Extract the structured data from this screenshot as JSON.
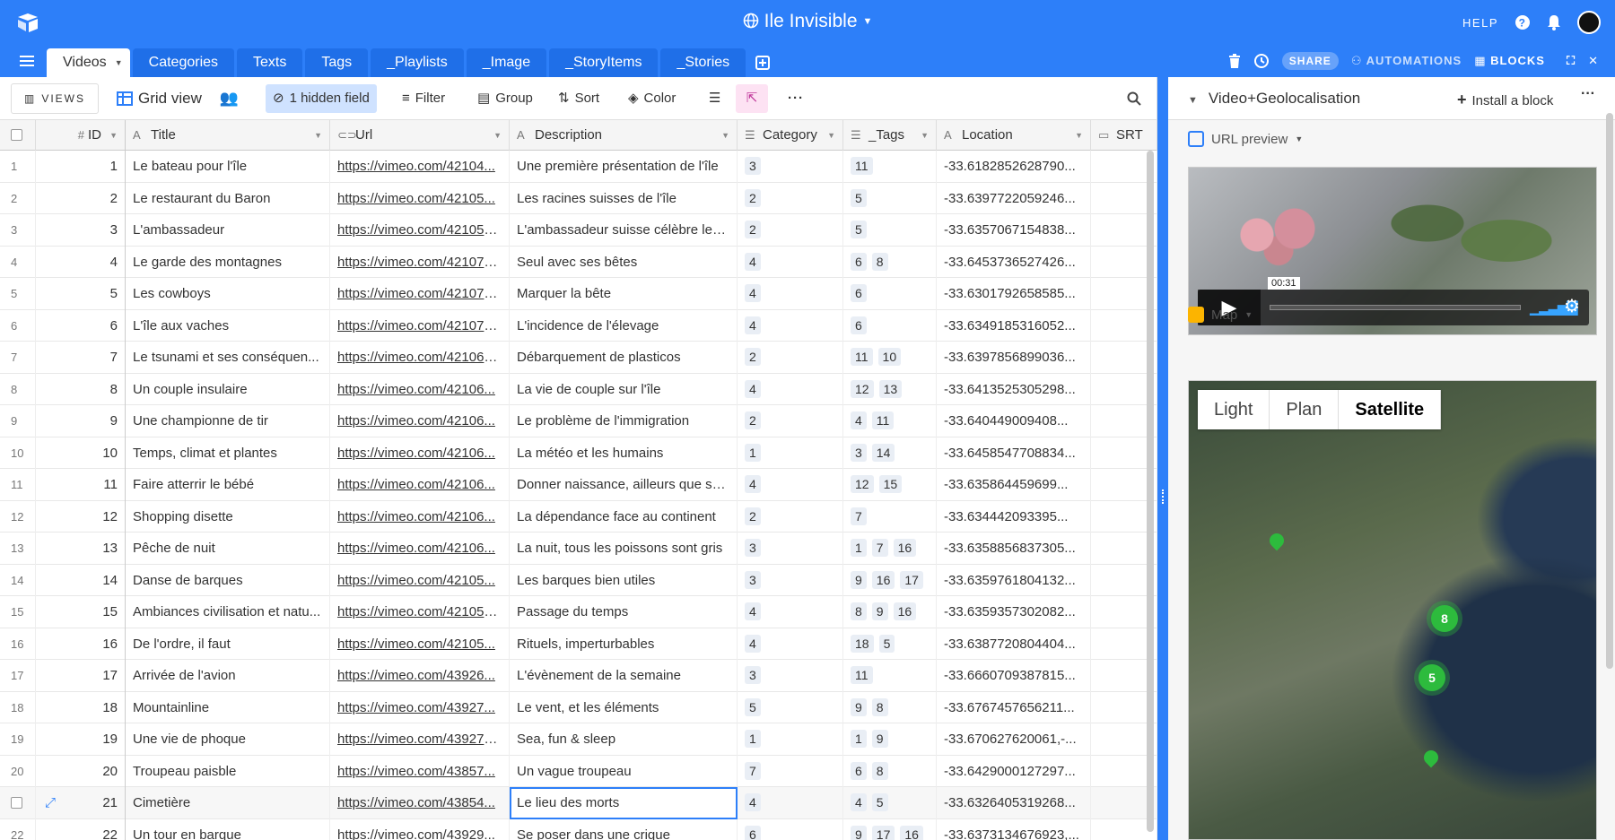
{
  "topbar": {
    "base_title": "Ile Invisible",
    "help_label": "HELP"
  },
  "tabs": [
    {
      "label": "Videos",
      "active": true
    },
    {
      "label": "Categories"
    },
    {
      "label": "Texts"
    },
    {
      "label": "Tags"
    },
    {
      "label": "_Playlists"
    },
    {
      "label": "_Image"
    },
    {
      "label": "_StoryItems"
    },
    {
      "label": "_Stories"
    }
  ],
  "tabs_right": {
    "share_label": "SHARE",
    "automations_label": "AUTOMATIONS",
    "blocks_label": "BLOCKS"
  },
  "toolbar": {
    "views_label": "VIEWS",
    "view_name": "Grid view",
    "hidden_field_label": "1 hidden field",
    "filter_label": "Filter",
    "group_label": "Group",
    "sort_label": "Sort",
    "color_label": "Color"
  },
  "columns": {
    "id": "ID",
    "title": "Title",
    "url": "Url",
    "description": "Description",
    "category": "Category",
    "tags": "_Tags",
    "location": "Location",
    "srt": "SRT"
  },
  "rows": [
    {
      "num": "1",
      "id": "1",
      "title": "Le bateau pour l'île",
      "url": "https://vimeo.com/42104...",
      "desc": "Une première présentation de l'île",
      "cat": "3",
      "tags": [
        "11"
      ],
      "loc": "-33.6182852628790..."
    },
    {
      "num": "2",
      "id": "2",
      "title": "Le restaurant du Baron",
      "url": "https://vimeo.com/42105...",
      "desc": "Les racines suisses de l'île",
      "cat": "2",
      "tags": [
        "5"
      ],
      "loc": "-33.6397722059246..."
    },
    {
      "num": "3",
      "id": "3",
      "title": "L'ambassadeur",
      "url": "https://vimeo.com/421051...",
      "desc": "L'ambassadeur suisse célèbre les...",
      "cat": "2",
      "tags": [
        "5"
      ],
      "loc": "-33.6357067154838..."
    },
    {
      "num": "4",
      "id": "4",
      "title": "Le garde des montagnes",
      "url": "https://vimeo.com/421079...",
      "desc": "Seul avec ses bêtes",
      "cat": "4",
      "tags": [
        "6",
        "8"
      ],
      "loc": "-33.6453736527426..."
    },
    {
      "num": "5",
      "id": "5",
      "title": "Les cowboys",
      "url": "https://vimeo.com/421078...",
      "desc": "Marquer la bête",
      "cat": "4",
      "tags": [
        "6"
      ],
      "loc": "-33.6301792658585..."
    },
    {
      "num": "6",
      "id": "6",
      "title": "L'île aux vaches",
      "url": "https://vimeo.com/421077...",
      "desc": "L'incidence de l'élevage",
      "cat": "4",
      "tags": [
        "6"
      ],
      "loc": "-33.6349185316052..."
    },
    {
      "num": "7",
      "id": "7",
      "title": "Le tsunami et ses conséquen...",
      "url": "https://vimeo.com/421067...",
      "desc": "Débarquement de plasticos",
      "cat": "2",
      "tags": [
        "11",
        "10"
      ],
      "loc": "-33.6397856899036..."
    },
    {
      "num": "8",
      "id": "8",
      "title": "Un couple insulaire",
      "url": "https://vimeo.com/42106...",
      "desc": "La vie de couple sur l'île",
      "cat": "4",
      "tags": [
        "12",
        "13"
      ],
      "loc": "-33.6413525305298..."
    },
    {
      "num": "9",
      "id": "9",
      "title": "Une championne de tir",
      "url": "https://vimeo.com/42106...",
      "desc": "Le problème de l'immigration",
      "cat": "2",
      "tags": [
        "4",
        "11"
      ],
      "loc": "-33.640449009408..."
    },
    {
      "num": "10",
      "id": "10",
      "title": "Temps, climat et plantes",
      "url": "https://vimeo.com/42106...",
      "desc": "La météo et les humains",
      "cat": "1",
      "tags": [
        "3",
        "14"
      ],
      "loc": "-33.6458547708834..."
    },
    {
      "num": "11",
      "id": "11",
      "title": "Faire atterrir le bébé",
      "url": "https://vimeo.com/42106...",
      "desc": "Donner naissance, ailleurs que su...",
      "cat": "4",
      "tags": [
        "12",
        "15"
      ],
      "loc": "-33.635864459699..."
    },
    {
      "num": "12",
      "id": "12",
      "title": "Shopping disette",
      "url": "https://vimeo.com/42106...",
      "desc": "La dépendance face au continent",
      "cat": "2",
      "tags": [
        "7"
      ],
      "loc": "-33.634442093395..."
    },
    {
      "num": "13",
      "id": "13",
      "title": "Pêche de nuit",
      "url": "https://vimeo.com/42106...",
      "desc": "La nuit, tous les poissons sont gris",
      "cat": "3",
      "tags": [
        "1",
        "7",
        "16"
      ],
      "loc": "-33.6358856837305..."
    },
    {
      "num": "14",
      "id": "14",
      "title": "Danse de barques",
      "url": "https://vimeo.com/42105...",
      "desc": "Les barques bien utiles",
      "cat": "3",
      "tags": [
        "9",
        "16",
        "17"
      ],
      "loc": "-33.6359761804132..."
    },
    {
      "num": "15",
      "id": "15",
      "title": "Ambiances civilisation et natu...",
      "url": "https://vimeo.com/421057...",
      "desc": "Passage du temps",
      "cat": "4",
      "tags": [
        "8",
        "9",
        "16"
      ],
      "loc": "-33.6359357302082..."
    },
    {
      "num": "16",
      "id": "16",
      "title": "De l'ordre, il faut",
      "url": "https://vimeo.com/42105...",
      "desc": "Rituels, imperturbables",
      "cat": "4",
      "tags": [
        "18",
        "5"
      ],
      "loc": "-33.6387720804404..."
    },
    {
      "num": "17",
      "id": "17",
      "title": "Arrivée de l'avion",
      "url": "https://vimeo.com/43926...",
      "desc": "L'évènement de la semaine",
      "cat": "3",
      "tags": [
        "11"
      ],
      "loc": "-33.6660709387815..."
    },
    {
      "num": "18",
      "id": "18",
      "title": "Mountainline",
      "url": "https://vimeo.com/43927...",
      "desc": "Le vent, et les éléments",
      "cat": "5",
      "tags": [
        "9",
        "8"
      ],
      "loc": "-33.6767457656211..."
    },
    {
      "num": "19",
      "id": "19",
      "title": "Une vie de phoque",
      "url": "https://vimeo.com/439271...",
      "desc": "Sea, fun & sleep",
      "cat": "1",
      "tags": [
        "1",
        "9"
      ],
      "loc": "-33.670627620061,-..."
    },
    {
      "num": "20",
      "id": "20",
      "title": "Troupeau paisble",
      "url": "https://vimeo.com/43857...",
      "desc": "Un vague troupeau",
      "cat": "7",
      "tags": [
        "6",
        "8"
      ],
      "loc": "-33.6429000127297..."
    },
    {
      "num": "",
      "id": "21",
      "title": "Cimetière",
      "url": "https://vimeo.com/43854...",
      "desc": "Le lieu des morts",
      "cat": "4",
      "tags": [
        "4",
        "5"
      ],
      "loc": "-33.6326405319268...",
      "selected": true
    },
    {
      "num": "22",
      "id": "22",
      "title": "Un tour en barque",
      "url": "https://vimeo.com/43929...",
      "desc": "Se poser dans une crique",
      "cat": "6",
      "tags": [
        "9",
        "17",
        "16"
      ],
      "loc": "-33.6373134676923,..."
    }
  ],
  "blocks_panel": {
    "title": "Video+Geolocalisation",
    "install_label": "Install a block",
    "url_preview_label": "URL preview",
    "video_time": "00:31",
    "map_label": "Map",
    "map_modes": [
      "Light",
      "Plan",
      "Satellite"
    ],
    "map_active_mode": "Satellite",
    "clusters": [
      "8",
      "5"
    ],
    "accent_color": "#2d7ff9",
    "pin_color": "#2dbb3d"
  }
}
